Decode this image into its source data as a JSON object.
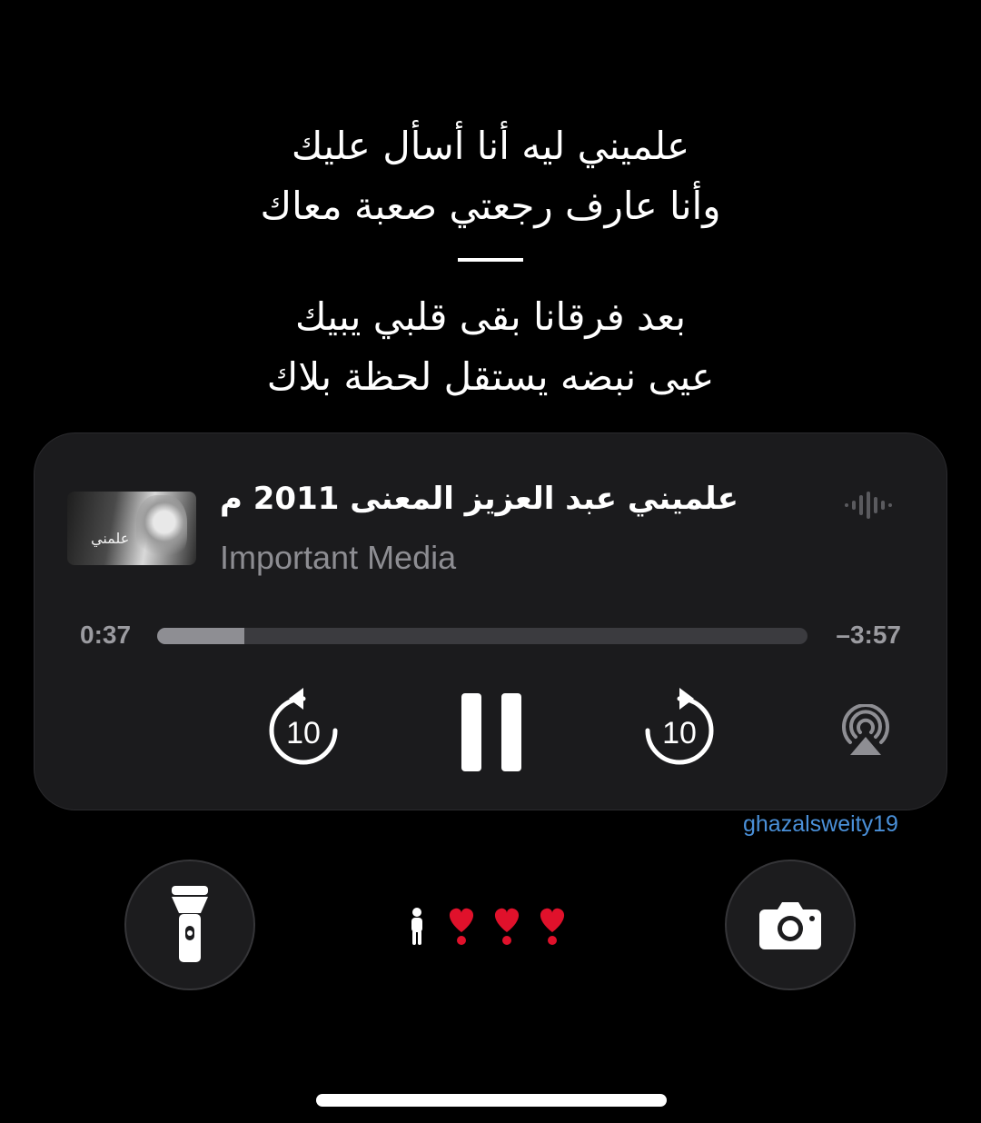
{
  "lyrics": {
    "stanza1": [
      "علميني ليه أنا أسأل عليك",
      "وأنا عارف رجعتي صعبة معاك"
    ],
    "stanza2": [
      "بعد فرقانا بقى قلبي يبيك",
      "عيى نبضه يستقل لحظة بلاك"
    ]
  },
  "now_playing": {
    "title": "علميني عبد العزيز المعنى 2011 م",
    "subtitle": "Important Media",
    "artwork_text": "علمني",
    "elapsed": "0:37",
    "remaining": "–3:57",
    "progress": 0.134,
    "skip_back_seconds": "10",
    "skip_forward_seconds": "10",
    "icons": {
      "waveform": "waveform-icon",
      "skip_back": "gobackward-10-icon",
      "play_state": "pause-icon",
      "skip_forward": "goforward-10-icon",
      "airplay": "airplay-icon"
    }
  },
  "handle": "ghazalsweity19",
  "lock_screen": {
    "left_button_icon": "flashlight-icon",
    "right_button_icon": "camera-icon",
    "status_icons": [
      "person-icon",
      "heart-icon",
      "heart-icon",
      "heart-icon"
    ]
  },
  "colors": {
    "background": "#000000",
    "player_bg": "#1b1b1d",
    "subtitle": "#8d8d92",
    "handle": "#4a90d9",
    "heart": "#e0112b"
  }
}
